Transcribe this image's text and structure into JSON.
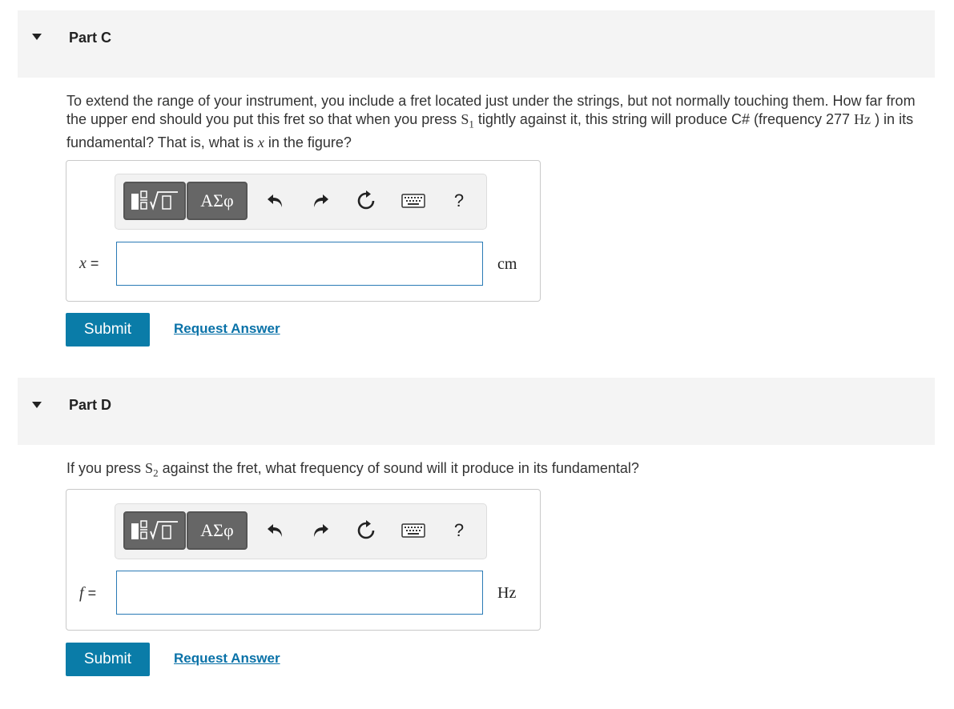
{
  "part_c": {
    "title": "Part C",
    "question_pre1": "To extend the range of your instrument, you include a fret located just under the strings, but not normally touching them. How far from the upper end should you put this fret so that when you press ",
    "s_letter": "S",
    "s_sub": "1",
    "question_pre2": " tightly against it, this string will produce C# (frequency 277 ",
    "freq_unit": "Hz",
    "question_pre3": " ) in its fundamental? That is, what is ",
    "x_var": "x",
    "question_pre4": " in the figure?",
    "var_label": "x",
    "equals": "=",
    "input_value": "",
    "unit": "cm",
    "submit_label": "Submit",
    "request_label": "Request Answer"
  },
  "part_d": {
    "title": "Part D",
    "question_pre1": "If you press ",
    "s_letter": "S",
    "s_sub": "2",
    "question_pre2": " against the fret, what frequency of sound will it produce in its fundamental?",
    "var_label": "f",
    "equals": "=",
    "input_value": "",
    "unit": "Hz",
    "submit_label": "Submit",
    "request_label": "Request Answer"
  },
  "toolbar": {
    "greek_label": "ΑΣφ",
    "help_label": "?",
    "icons": [
      "templates-icon",
      "greek-symbols-icon",
      "undo-icon",
      "redo-icon",
      "reset-icon",
      "keyboard-icon",
      "help-icon"
    ]
  }
}
